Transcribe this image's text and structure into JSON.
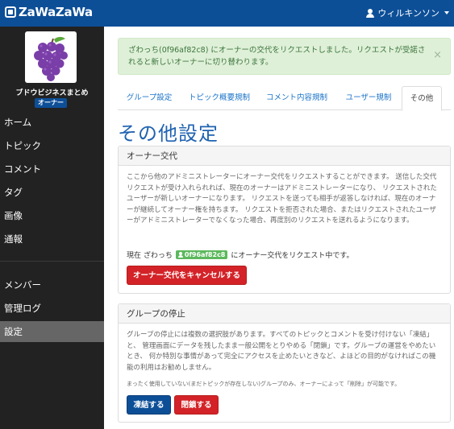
{
  "header": {
    "logo_text": "ZaWaZaWa",
    "user_name": "ウィルキンソン"
  },
  "sidebar": {
    "group_name": "ブドウビジネスまとめ",
    "role_badge": "オーナー",
    "nav_top": [
      "ホーム",
      "トピック",
      "コメント",
      "タグ",
      "画像",
      "通報"
    ],
    "nav_bottom": [
      "メンバー",
      "管理ログ",
      "設定"
    ],
    "active_item": "設定"
  },
  "alert": {
    "message": "ざわっち(0f96af82c8) にオーナーの交代をリクエストしました。リクエストが受諾されると新しいオーナーに切り替わります。",
    "close_symbol": "×"
  },
  "tabs": [
    "グループ設定",
    "トピック概要規制",
    "コメント内容規制",
    "ユーザー規制",
    "その他"
  ],
  "active_tab": "その他",
  "page_title": "その他設定",
  "owner_panel": {
    "title": "オーナー交代",
    "body": "ここから他のアドミニストレーターにオーナー交代をリクエストすることができます。 送信した交代リクエストが受け入れられれば、現在のオーナーはアドミニストレーターになり、 リクエストされたユーザーが新しいオーナーになります。 リクエストを送っても相手が返答しなければ、現在のオーナーが継続してオーナー権を持ちます。 リクエストを拒否された場合、またはリクエストされたユーザーがアドミニストレーターでなくなった場合、再度別のリクエストを送れるようになります。",
    "status_prefix": "現在 ざわっち",
    "status_user_id": "0f96af82c8",
    "status_suffix": "にオーナー交代をリクエスト中です。",
    "cancel_button": "オーナー交代をキャンセルする"
  },
  "suspend_panel": {
    "title": "グループの停止",
    "body": "グループの停止には複数の選択肢があります。すべてのトピックとコメントを受け付けない「凍結」と、 管理画面にデータを残したまま一般公開をとりやめる「閉鎖」です。グループの運営をやめたいとき、 何か特別な事情があって完全にアクセスを止めたいときなど、よほどの目的がなければこの機能の利用はお勧めしません。",
    "note": "まったく使用していない(まだトピックが存在しない)グループのみ、オーナーによって「削除」が可能です。",
    "freeze_button": "凍結する",
    "close_button": "閉鎖する"
  },
  "colors": {
    "header_bg": "#0d4f97",
    "sidebar_bg": "#222222",
    "active_nav_bg": "#666666",
    "alert_bg": "#dff0d8",
    "danger": "#d32328",
    "primary": "#0d4f97",
    "badge_green": "#5cb85c"
  }
}
